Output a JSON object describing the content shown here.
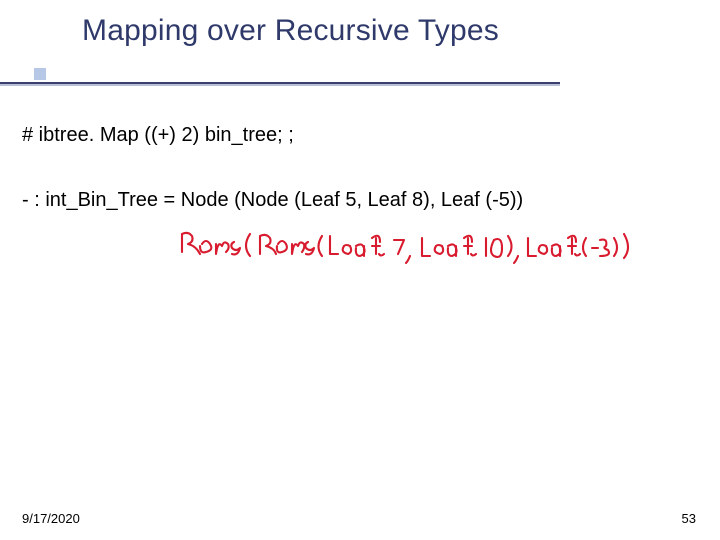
{
  "title": "Mapping over Recursive Types",
  "code_line": "# ibtree. Map ((+) 2) bin_tree; ;",
  "result_line": "- : int_Bin_Tree = Node (Node (Leaf 5, Leaf 8), Leaf (-5))",
  "handwritten": "Node ( Node (Leaf 7, Leaf 10), Leaf(-3))",
  "footer": {
    "date": "9/17/2020",
    "page": "53"
  }
}
